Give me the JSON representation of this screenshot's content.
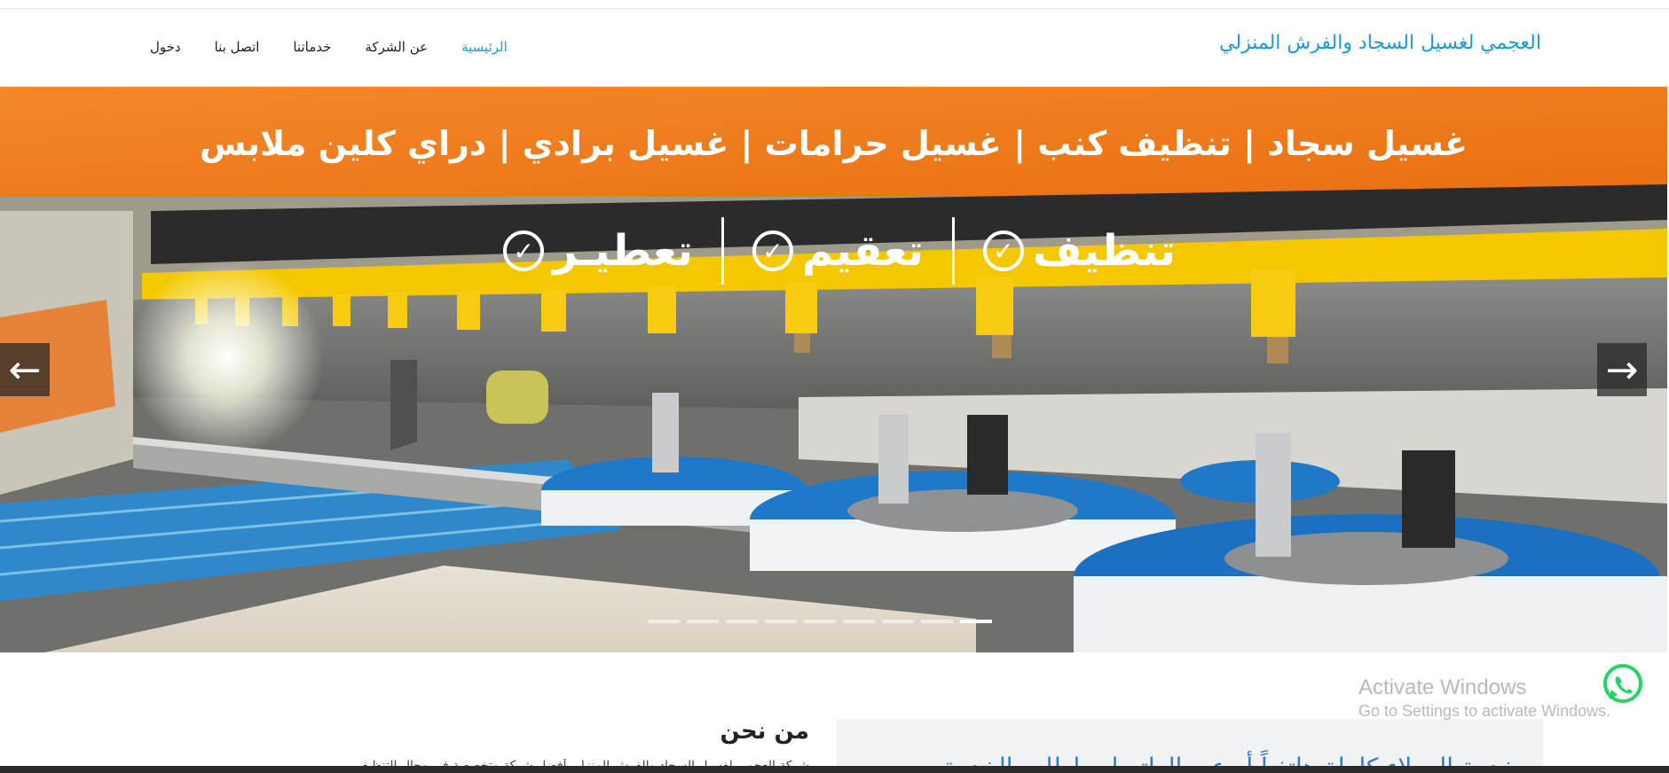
{
  "header": {
    "brand": "العجمي لغسيل السجاد والفرش المنزلي",
    "nav": [
      {
        "label": "الرئيسية",
        "active": true
      },
      {
        "label": "عن الشركة",
        "active": false
      },
      {
        "label": "خدماتنا",
        "active": false
      },
      {
        "label": "اتصل بنا",
        "active": false
      },
      {
        "label": "دخول",
        "active": false
      }
    ]
  },
  "hero": {
    "banner_text": "غسيل سجاد | تنظيف كنب | غسيل حرامات | غسيل برادي | دراي كلين ملابس",
    "features": [
      "تنظيف",
      "تعقيم",
      "تعطيـر"
    ],
    "slides_count": 9,
    "active_slide": 9,
    "prev_icon": "arrow-left-icon",
    "next_icon": "arrow-right-icon"
  },
  "about": {
    "title": "من نحن",
    "text": "شركة العجمي لغسيل السجاد والفرش المنزلي أفضل شركة متخصصة في مجال التنظيف"
  },
  "side_box": {
    "text": "خدمة العملاء كاملة هاتفياً أو عبر الواتساب اطلب الخدمة"
  },
  "whatsapp": {
    "icon": "whatsapp-icon",
    "color": "#25d366"
  },
  "watermark": {
    "title": "Activate Windows",
    "subtitle": "Go to Settings to activate Windows."
  },
  "colors": {
    "accent": "#1a9bd7",
    "banner_orange": "#f08020",
    "machine_yellow": "#f5c400",
    "brush_blue": "#1f78c8"
  }
}
